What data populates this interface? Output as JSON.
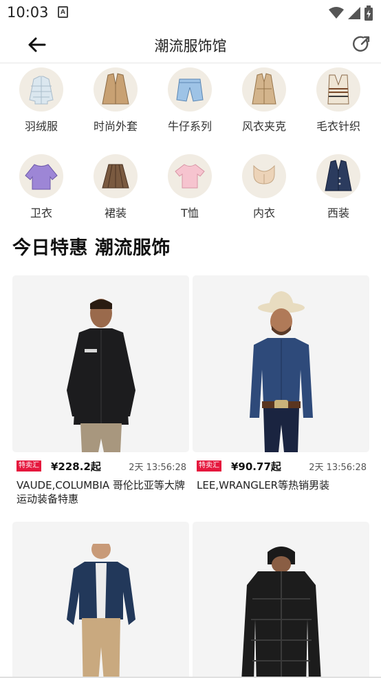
{
  "status_bar": {
    "time": "10:03",
    "notif_glyph": "A"
  },
  "app_bar": {
    "title": "潮流服饰馆"
  },
  "categories": [
    {
      "label": "羽绒服",
      "icon": "puffer-jacket-icon"
    },
    {
      "label": "时尚外套",
      "icon": "blazer-icon"
    },
    {
      "label": "牛仔系列",
      "icon": "denim-shorts-icon"
    },
    {
      "label": "风衣夹克",
      "icon": "trench-coat-icon"
    },
    {
      "label": "毛衣针织",
      "icon": "knit-vest-icon"
    },
    {
      "label": "卫衣",
      "icon": "sweatshirt-icon"
    },
    {
      "label": "裙装",
      "icon": "pleated-skirt-icon"
    },
    {
      "label": "T恤",
      "icon": "tshirt-icon"
    },
    {
      "label": "内衣",
      "icon": "bra-icon"
    },
    {
      "label": "西装",
      "icon": "suit-jacket-icon"
    }
  ],
  "section": {
    "title": "今日特惠 潮流服饰"
  },
  "products": [
    {
      "tag": "特卖汇",
      "price": "¥228.2起",
      "timer": "2天 13:56:28",
      "title": "VAUDE,COLUMBIA 哥伦比亚等大牌运动装备特惠",
      "image": "man-black-jacket"
    },
    {
      "tag": "特卖汇",
      "price": "¥90.77起",
      "timer": "2天 13:56:28",
      "title": "LEE,WRANGLER等热销男装",
      "image": "man-cowboy-denim-shirt"
    },
    {
      "image": "man-navy-jacket-khaki"
    },
    {
      "image": "man-black-puffer"
    }
  ],
  "colors": {
    "tag_red": "#e5173d",
    "card_bg": "#f4f4f4",
    "category_bg": "#f1ece3"
  }
}
